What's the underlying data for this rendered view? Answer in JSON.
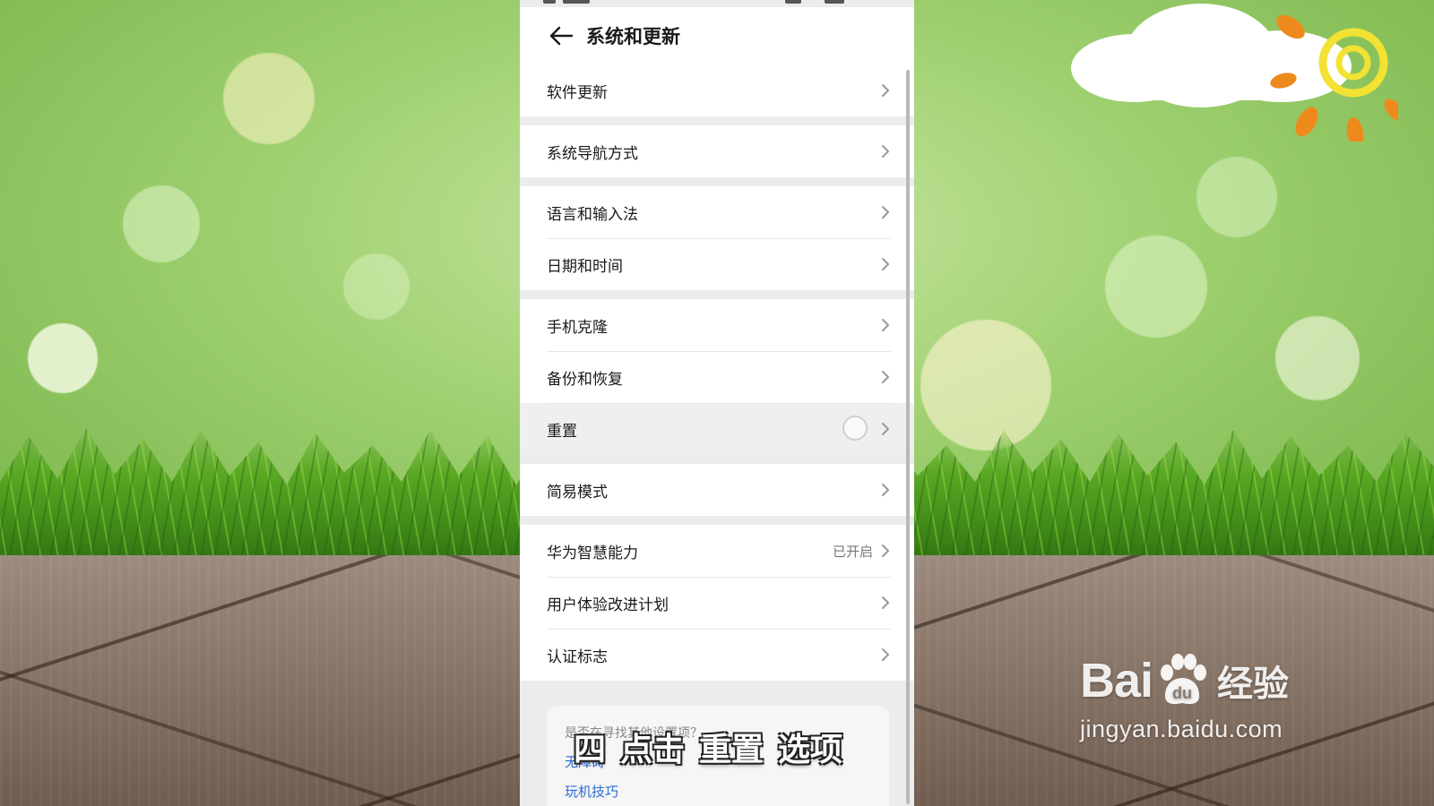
{
  "screen": {
    "title": "系统和更新"
  },
  "groups": [
    {
      "items": [
        {
          "label": "软件更新",
          "value": ""
        }
      ]
    },
    {
      "items": [
        {
          "label": "系统导航方式",
          "value": ""
        }
      ]
    },
    {
      "items": [
        {
          "label": "语言和输入法",
          "value": ""
        },
        {
          "label": "日期和时间",
          "value": ""
        }
      ]
    },
    {
      "items": [
        {
          "label": "手机克隆",
          "value": ""
        },
        {
          "label": "备份和恢复",
          "value": ""
        },
        {
          "label": "重置",
          "value": ""
        }
      ]
    },
    {
      "items": [
        {
          "label": "简易模式",
          "value": ""
        }
      ]
    },
    {
      "items": [
        {
          "label": "华为智慧能力",
          "value": "已开启"
        },
        {
          "label": "用户体验改进计划",
          "value": ""
        },
        {
          "label": "认证标志",
          "value": ""
        }
      ]
    }
  ],
  "suggestions": {
    "question": "是否在寻找其他设置项？",
    "links": [
      "无障碍",
      "玩机技巧"
    ]
  },
  "caption": {
    "parts": [
      "四",
      "点击",
      "重置",
      "选项"
    ]
  },
  "watermark": {
    "logo_text": "Bai",
    "logo_suffix": "经验",
    "url": "jingyan.baidu.com"
  },
  "colors": {
    "link": "#2a6bd3",
    "background_green": "#9fd070",
    "wood": "#8a786a"
  }
}
